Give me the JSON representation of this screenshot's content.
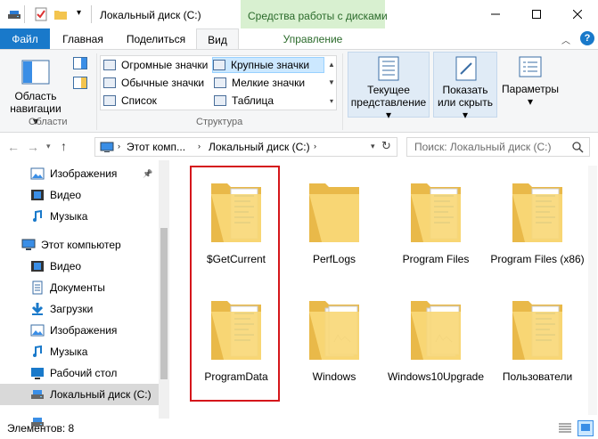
{
  "window": {
    "title": "Локальный диск (C:)",
    "contextual_tab_group": "Средства работы с дисками"
  },
  "ribbon_tabs": {
    "file": "Файл",
    "home": "Главная",
    "share": "Поделиться",
    "view": "Вид",
    "manage": "Управление"
  },
  "ribbon": {
    "panes_group": {
      "nav_pane_label_1": "Область",
      "nav_pane_label_2": "навигации",
      "group_label": "Области"
    },
    "layout_group": {
      "items": [
        "Огромные значки",
        "Крупные значки",
        "Обычные значки",
        "Мелкие значки",
        "Список",
        "Таблица"
      ],
      "selected": "Крупные значки",
      "group_label": "Структура"
    },
    "current_view": {
      "line1": "Текущее",
      "line2": "представление"
    },
    "show_hide": {
      "line1": "Показать",
      "line2": "или скрыть"
    },
    "options": {
      "label": "Параметры"
    }
  },
  "address": {
    "crumbs": [
      "Этот комп...",
      "Локальный диск (C:)"
    ],
    "search_placeholder": "Поиск: Локальный диск (C:)"
  },
  "nav": {
    "quick": [
      {
        "label": "Изображения",
        "icon": "pictures-icon"
      },
      {
        "label": "Видео",
        "icon": "video-icon"
      },
      {
        "label": "Музыка",
        "icon": "music-icon"
      }
    ],
    "this_pc": "Этот компьютер",
    "pc_items": [
      {
        "label": "Видео",
        "icon": "video-icon"
      },
      {
        "label": "Документы",
        "icon": "documents-icon"
      },
      {
        "label": "Загрузки",
        "icon": "downloads-icon"
      },
      {
        "label": "Изображения",
        "icon": "pictures-icon"
      },
      {
        "label": "Музыка",
        "icon": "music-icon"
      },
      {
        "label": "Рабочий стол",
        "icon": "desktop-icon"
      },
      {
        "label": "Локальный диск (C:)",
        "icon": "drive-icon"
      }
    ]
  },
  "folders": [
    {
      "name": "$GetCurrent",
      "variant": "docs"
    },
    {
      "name": "PerfLogs",
      "variant": "plain"
    },
    {
      "name": "Program Files",
      "variant": "docs"
    },
    {
      "name": "Program Files (x86)",
      "variant": "docs"
    },
    {
      "name": "ProgramData",
      "variant": "docs"
    },
    {
      "name": "Windows",
      "variant": "pages"
    },
    {
      "name": "Windows10Upgrade",
      "variant": "pages"
    },
    {
      "name": "Пользователи",
      "variant": "docs"
    }
  ],
  "status": {
    "items_count": "Элементов: 8"
  },
  "colors": {
    "accent": "#1979ca",
    "contextual": "#d8f0d0",
    "highlight": "#d5161b",
    "folder": "#f8d878"
  }
}
